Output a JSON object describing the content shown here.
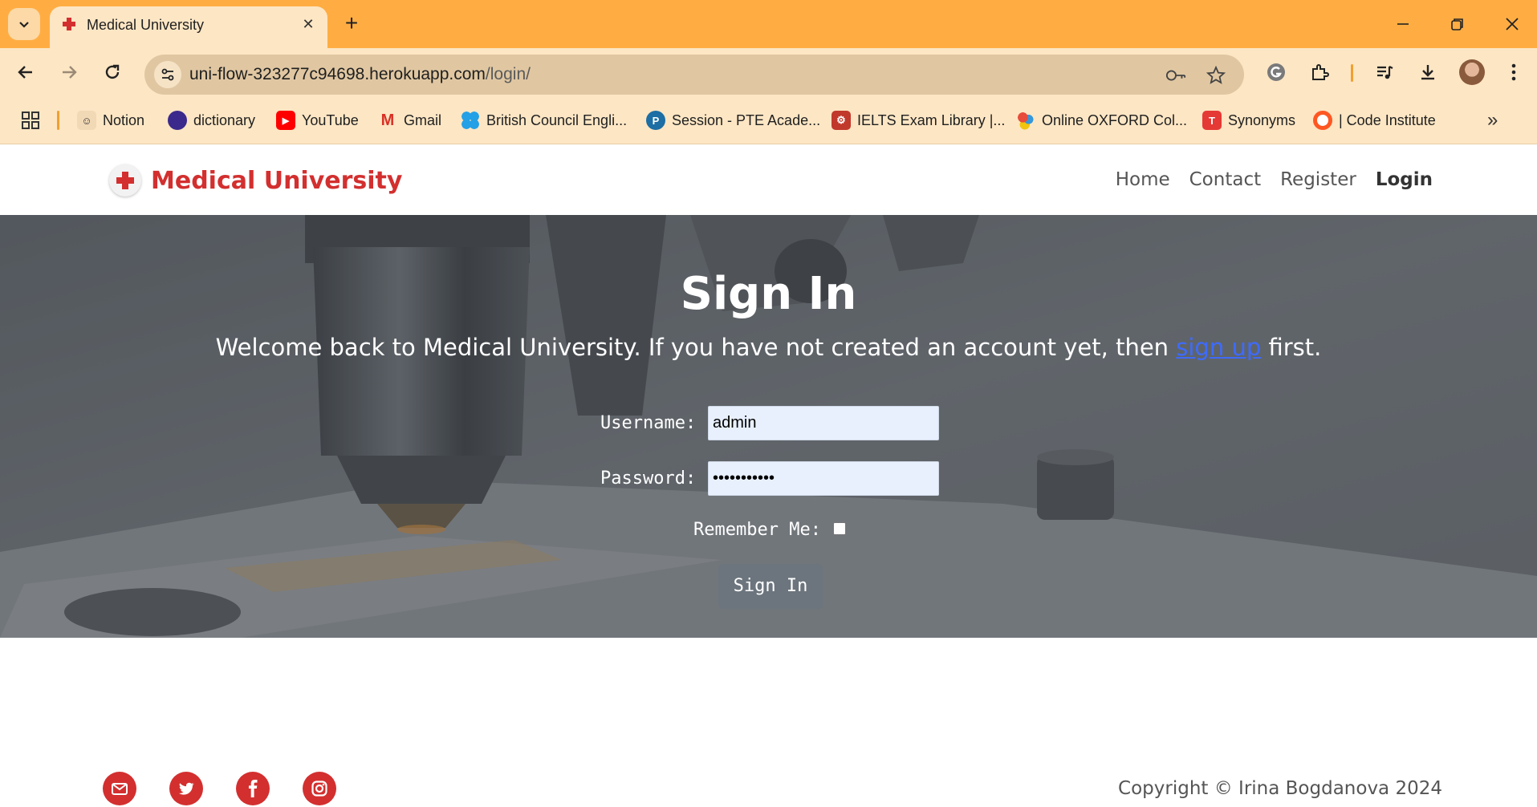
{
  "browser": {
    "tab_title": "Medical University",
    "url_host": "uni-flow-323277c94698.herokuapp.com",
    "url_path": "/login/",
    "bookmarks": [
      {
        "label": "Notion",
        "icon": "notion-icon"
      },
      {
        "label": "dictionary",
        "icon": "dictionary-icon"
      },
      {
        "label": "YouTube",
        "icon": "youtube-icon"
      },
      {
        "label": "Gmail",
        "icon": "gmail-icon"
      },
      {
        "label": "British Council Engli...",
        "icon": "british-council-icon"
      },
      {
        "label": "Session - PTE Acade...",
        "icon": "pte-icon"
      },
      {
        "label": "IELTS Exam Library |...",
        "icon": "ielts-icon"
      },
      {
        "label": "Online OXFORD Col...",
        "icon": "oxford-icon"
      },
      {
        "label": "Synonyms",
        "icon": "synonyms-icon"
      },
      {
        "label": "| Code Institute",
        "icon": "code-institute-icon"
      }
    ]
  },
  "site": {
    "brand": "Medical University",
    "nav": [
      "Home",
      "Contact",
      "Register",
      "Login"
    ],
    "active_nav": "Login",
    "accent_color": "#d32f2f"
  },
  "signin": {
    "title": "Sign In",
    "subtitle_pre": "Welcome back to Medical University. If you have not created an account yet, then ",
    "subtitle_link": "sign up",
    "subtitle_post": " first.",
    "username_label": "Username:",
    "username_value": "admin",
    "password_label": "Password:",
    "password_value": "•••••••••••",
    "remember_label": "Remember Me:",
    "remember_checked": false,
    "button_label": "Sign In"
  },
  "footer": {
    "social": [
      "mail-icon",
      "twitter-icon",
      "facebook-icon",
      "instagram-icon"
    ],
    "copyright": "Copyright © Irina Bogdanova 2024"
  }
}
